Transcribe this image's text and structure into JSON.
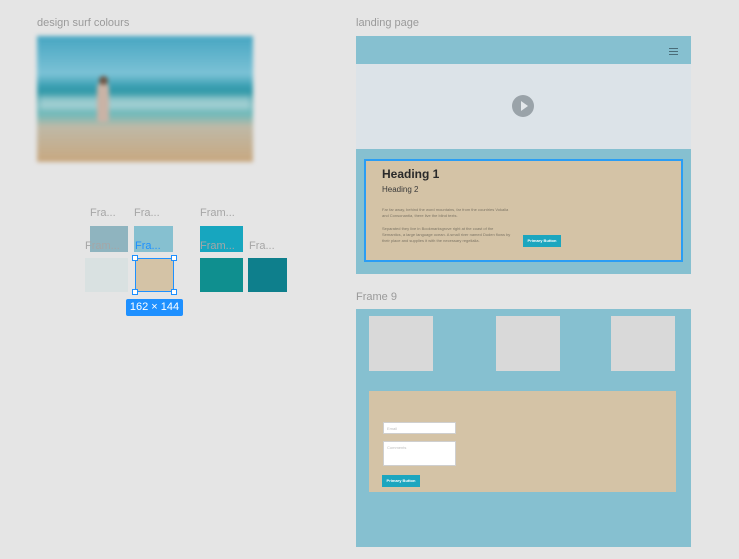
{
  "canvas": {
    "frames": [
      {
        "label": "design surf colours"
      },
      {
        "label": "landing page"
      },
      {
        "label": "Frame 9"
      }
    ]
  },
  "swatches": {
    "row1_labels": [
      "Fra...",
      "Fra...",
      "Fram..."
    ],
    "row2_labels": [
      "Fram...",
      "Fra...",
      "Fram...",
      "Fra..."
    ],
    "colors": {
      "row1": [
        "#8fb4bf",
        "#86c0d0",
        "#17a6bf"
      ],
      "row2": [
        "#d9e1e1",
        "#d4c3a6",
        "#0f8f8f",
        "#0e7f8c"
      ]
    }
  },
  "selection": {
    "dimensions": "162 × 144"
  },
  "landing": {
    "heading1": "Heading 1",
    "heading2": "Heading 2",
    "paragraph1": "Far far away, behind the word mountains, far from the countries Vokalia and Consonantia, there live the blind texts.",
    "paragraph2": "Separated they live in Bookmarksgrove right at the coast of the Semantics, a large language ocean. A small river named Duden flows by their place and supplies it with the necessary regelialia.",
    "button_label": "Primary Button"
  },
  "frame9": {
    "email_placeholder": "Email",
    "comments_placeholder": "Comments",
    "button_label": "Primary Button"
  },
  "icons": [
    "hamburger-menu-icon",
    "play-icon"
  ],
  "colors": {
    "canvas_bg": "#e5e5e5",
    "frame_bg": "#86c0d0",
    "sand": "#d4c3a6",
    "accent": "#1ca6bf",
    "selection": "#1e90ff"
  }
}
